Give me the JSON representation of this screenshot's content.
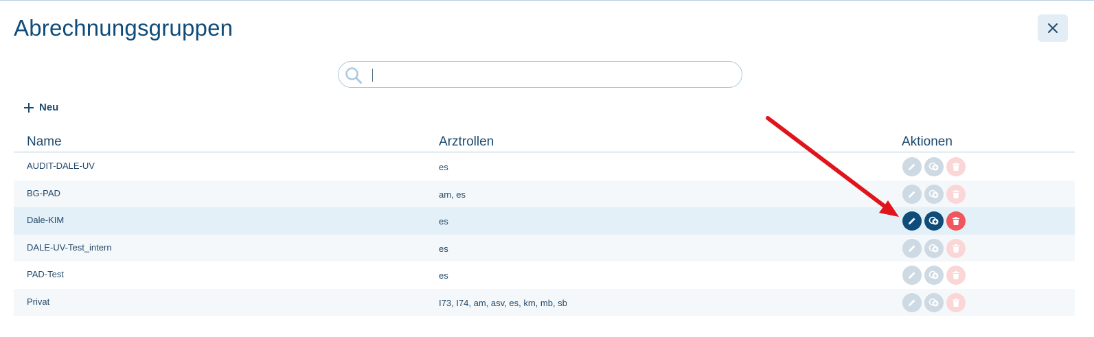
{
  "title": "Abrechnungsgruppen",
  "search": {
    "value": "",
    "placeholder": ""
  },
  "new_button": {
    "label": "Neu"
  },
  "columns": {
    "name": "Name",
    "roles": "Arztrollen",
    "actions": "Aktionen"
  },
  "rows": [
    {
      "name": "AUDIT-DALE-UV",
      "roles": "es",
      "selected": false
    },
    {
      "name": "BG-PAD",
      "roles": "am, es",
      "selected": false
    },
    {
      "name": "Dale-KIM",
      "roles": "es",
      "selected": true
    },
    {
      "name": "DALE-UV-Test_intern",
      "roles": "es",
      "selected": false
    },
    {
      "name": "PAD-Test",
      "roles": "es",
      "selected": false
    },
    {
      "name": "Privat",
      "roles": "I73, I74, am, asv, es, km, mb, sb",
      "selected": false
    }
  ],
  "colors": {
    "primary": "#0f4c7a",
    "action_inactive": "#cdd9e3",
    "delete_active": "#f0565c",
    "delete_inactive": "#fbd6d6",
    "arrow": "#e0141b",
    "row_selected": "#e4f0f7"
  },
  "icons": {
    "close": "close-icon",
    "search": "search-icon",
    "new": "plus-icon",
    "edit": "pencil-icon",
    "copy": "copy-plus-icon",
    "delete": "trash-icon"
  }
}
